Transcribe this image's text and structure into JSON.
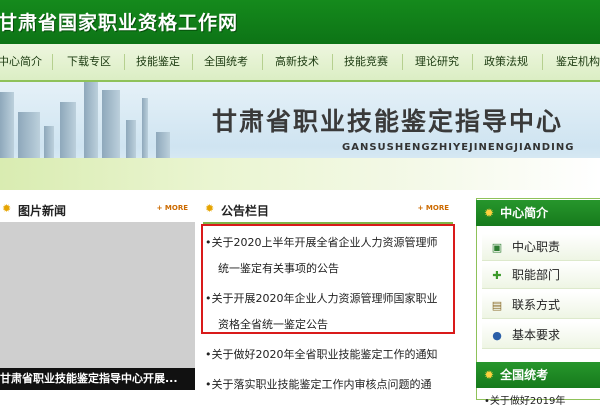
{
  "header": {
    "site_title": "甘肃省国家职业资格工作网"
  },
  "nav": {
    "items": [
      {
        "label": "中心简介"
      },
      {
        "label": "下载专区"
      },
      {
        "label": "技能鉴定"
      },
      {
        "label": "全国统考"
      },
      {
        "label": "高新技术"
      },
      {
        "label": "技能竞赛"
      },
      {
        "label": "理论研究"
      },
      {
        "label": "政策法规"
      },
      {
        "label": "鉴定机构"
      }
    ]
  },
  "banner": {
    "title": "甘肃省职业技能鉴定指导中心",
    "subtitle": "GANSUSHENGZHIYEJINENGJIANDING"
  },
  "photo_news": {
    "title": "图片新闻",
    "more": "+ MORE",
    "caption": "甘肃省职业技能鉴定指导中心开展..."
  },
  "announcements": {
    "title": "公告栏目",
    "more": "+ MORE",
    "items": [
      {
        "line1": "•关于2020上半年开展全省企业人力资源管理师",
        "line2": "统一鉴定有关事项的公告"
      },
      {
        "line1": "•关于开展2020年企业人力资源管理师国家职业",
        "line2": "资格全省统一鉴定公告"
      },
      {
        "line1": "•关于做好2020年全省职业技能鉴定工作的通知"
      },
      {
        "line1": "•关于落实职业技能鉴定工作内审核点问题的通"
      }
    ]
  },
  "center_intro": {
    "title": "中心简介",
    "items": [
      {
        "label": "中心职责",
        "icon": "book-icon"
      },
      {
        "label": "职能部门",
        "icon": "plus-icon"
      },
      {
        "label": "联系方式",
        "icon": "document-icon"
      },
      {
        "label": "基本要求",
        "icon": "person-icon"
      }
    ]
  },
  "national_exam": {
    "title": "全国统考",
    "first_item": "•关于做好2019年"
  }
}
